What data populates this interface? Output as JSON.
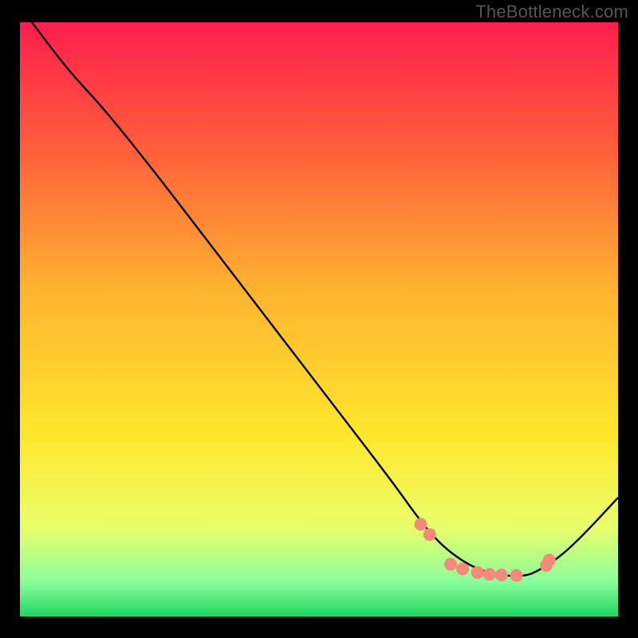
{
  "watermark": "TheBottleneck.com",
  "chart_data": {
    "type": "line",
    "title": "",
    "xlabel": "",
    "ylabel": "",
    "xlim": [
      0,
      100
    ],
    "ylim": [
      0,
      100
    ],
    "grid": false,
    "series": [
      {
        "name": "curve",
        "color": "#000000",
        "x": [
          2,
          8,
          14,
          22,
          30,
          38,
          46,
          54,
          62,
          67,
          70,
          73,
          76,
          79,
          82,
          84,
          86,
          90,
          94,
          100
        ],
        "y": [
          100,
          92,
          85.5,
          75.5,
          65,
          54.5,
          44,
          33.5,
          23,
          16,
          12.5,
          10,
          8.2,
          7.2,
          6.8,
          6.8,
          7.3,
          9.8,
          13.5,
          20
        ]
      }
    ],
    "markers": {
      "name": "dots",
      "color": "#f58a7a",
      "radius": 8,
      "x": [
        67,
        68.5,
        72,
        74,
        76.5,
        78.5,
        80.5,
        83,
        88,
        88.5
      ],
      "y": [
        15.5,
        13.8,
        8.8,
        8,
        7.4,
        7.1,
        7.0,
        6.9,
        8.6,
        9.5
      ]
    },
    "gradient_stops": [
      {
        "offset": 0,
        "color": "#ff1e4e"
      },
      {
        "offset": 20,
        "color": "#ff5a3c"
      },
      {
        "offset": 45,
        "color": "#ffb330"
      },
      {
        "offset": 70,
        "color": "#ffe82e"
      },
      {
        "offset": 85,
        "color": "#e9ff6a"
      },
      {
        "offset": 94,
        "color": "#8cff9a"
      },
      {
        "offset": 100,
        "color": "#20d765"
      }
    ]
  }
}
